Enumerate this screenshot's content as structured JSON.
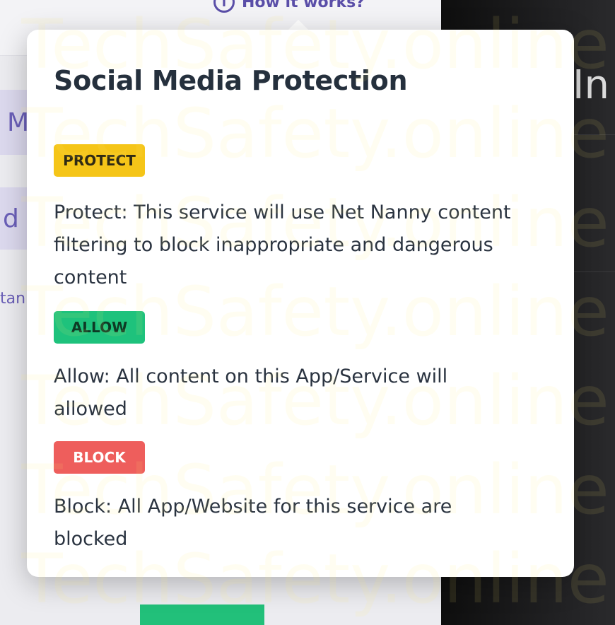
{
  "background": {
    "how_link_label": "How it works?",
    "how_link_icon": "info-icon",
    "side_chip_1": "M",
    "side_chip_2": "d",
    "side_text": "tan",
    "dark_text": "In"
  },
  "popover": {
    "title": "Social Media Protection",
    "items": [
      {
        "badge": "PROTECT",
        "badge_color": "#f5c518",
        "description": "Protect: This service will use Net Nanny content filtering to block inappropriate and dangerous content"
      },
      {
        "badge": "ALLOW",
        "badge_color": "#1ec27c",
        "description": "Allow: All content on this App/Service will allowed"
      },
      {
        "badge": "BLOCK",
        "badge_color": "#ee5e5c",
        "description": "Block: All App/Website for this service are blocked"
      }
    ]
  },
  "watermark": "TechSafety.online",
  "colors": {
    "accent_purple": "#5a4ea8",
    "allow_green": "#1ec27c",
    "protect_yellow": "#f5c518",
    "block_red": "#ee5e5c"
  }
}
